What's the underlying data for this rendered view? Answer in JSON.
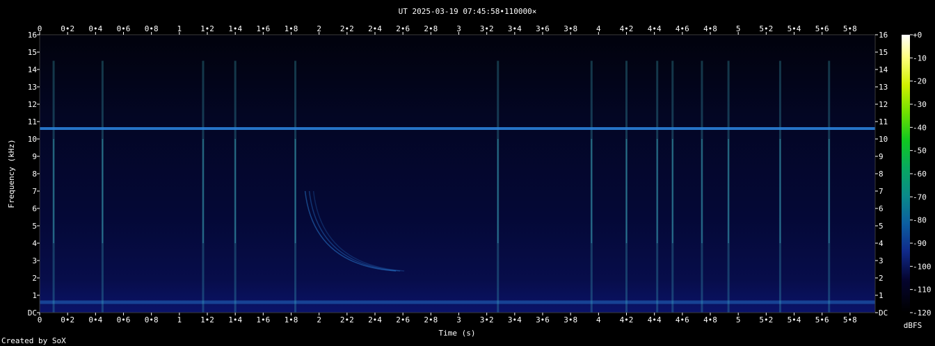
{
  "chart_data": {
    "type": "heatmap",
    "title": "UT 2025-03-19 07:45:58•110000×",
    "xlabel": "Time (s)",
    "ylabel": "Frequency (kHz)",
    "xlim": [
      0,
      5.98
    ],
    "ylim": [
      0,
      16
    ],
    "x_ticks": [
      "0",
      "0•2",
      "0•4",
      "0•6",
      "0•8",
      "1",
      "1•2",
      "1•4",
      "1•6",
      "1•8",
      "2",
      "2•2",
      "2•4",
      "2•6",
      "2•8",
      "3",
      "3•2",
      "3•4",
      "3•6",
      "3•8",
      "4",
      "4•2",
      "4•4",
      "4•6",
      "4•8",
      "5",
      "5•2",
      "5•4",
      "5•6",
      "5•8"
    ],
    "y_ticks": [
      "DC",
      "1",
      "2",
      "3",
      "4",
      "5",
      "6",
      "7",
      "8",
      "9",
      "10",
      "11",
      "12",
      "13",
      "14",
      "15",
      "16"
    ],
    "colorbar": {
      "label": "dBFS",
      "ticks": [
        "+0",
        "-10",
        "-20",
        "-30",
        "-40",
        "-50",
        "-60",
        "-70",
        "-80",
        "-90",
        "-100",
        "-110",
        "-120"
      ],
      "range": [
        -120,
        0
      ]
    },
    "features": {
      "tone_khz": 10.6,
      "low_band_khz": [
        0.5,
        0.7
      ],
      "transient_times_s": [
        0.1,
        0.45,
        1.17,
        1.4,
        1.83,
        3.28,
        3.95,
        4.2,
        4.42,
        4.53,
        4.74,
        4.93,
        5.3,
        5.65
      ],
      "sweep": {
        "start_s": 1.9,
        "end_s": 2.55,
        "start_khz": 7.0,
        "end_khz": 2.4
      }
    }
  },
  "credit": "Created by SoX",
  "colors": {
    "background": "#000000",
    "plot_floor": "#02031e",
    "tone": "#2a7fd8",
    "transient": "#3fb0c0",
    "text": "#ffffff"
  }
}
